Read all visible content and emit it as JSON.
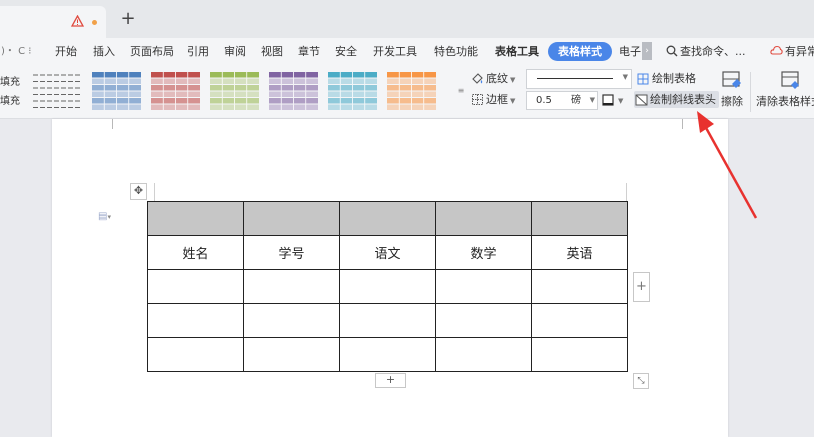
{
  "tabbar": {
    "add_tab_label": "+"
  },
  "menu": {
    "left_glyphs": ")・ C  ⁝",
    "items": [
      "开始",
      "插入",
      "页面布局",
      "引用",
      "审阅",
      "视图",
      "章节",
      "安全",
      "开发工具",
      "特色功能",
      "表格工具",
      "表格样式",
      "电子"
    ],
    "search_label": "查找命令、...",
    "sync_label": "有异常"
  },
  "ribbon": {
    "fill_labels": [
      "填充",
      "填充"
    ],
    "shading_label": "底纹",
    "border_label": "边框",
    "line_width_value": "0.5",
    "line_width_unit": "磅",
    "draw_table_label": "绘制表格",
    "draw_diagonal_label": "绘制斜线表头",
    "erase_label": "擦除",
    "clear_style_label": "清除表格样式",
    "swatch_colors": [
      "#888888",
      "#4f81bd",
      "#c0504d",
      "#9bbb59",
      "#8064a2",
      "#4bacc6",
      "#f79646"
    ]
  },
  "table": {
    "headers": [
      "姓名",
      "学号",
      "语文",
      "数学",
      "英语"
    ]
  },
  "controls": {
    "add_row": "+",
    "add_column": "+"
  }
}
